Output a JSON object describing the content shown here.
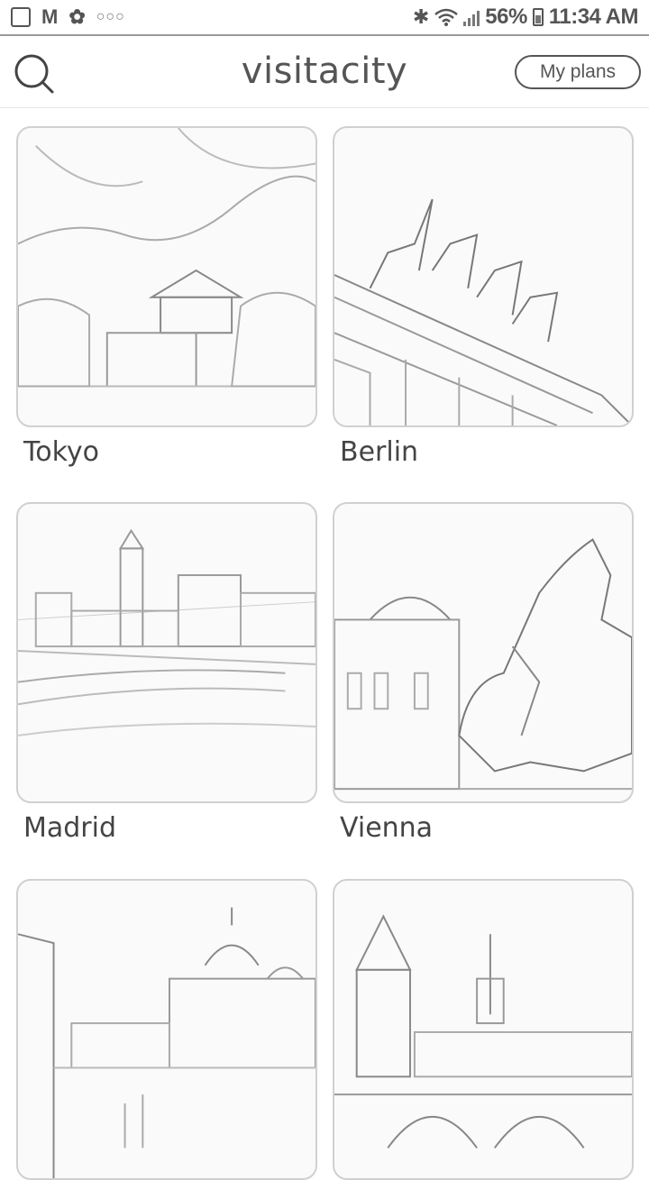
{
  "status_bar": {
    "battery": "56%",
    "time": "11:34 AM",
    "left_icons": [
      "gallery-icon",
      "gmail-icon",
      "flower-icon",
      "more-dots-icon"
    ],
    "right_icons": [
      "bluetooth-icon",
      "wifi-icon",
      "signal-icon",
      "battery-icon"
    ]
  },
  "header": {
    "logo": "visitacity",
    "my_plans_label": "My plans"
  },
  "cities": [
    {
      "name": "Tokyo"
    },
    {
      "name": "Berlin"
    },
    {
      "name": "Madrid"
    },
    {
      "name": "Vienna"
    },
    {
      "name": ""
    },
    {
      "name": ""
    }
  ],
  "colors": {
    "text": "#444444",
    "border": "#d0d0d0",
    "background": "#ffffff"
  }
}
